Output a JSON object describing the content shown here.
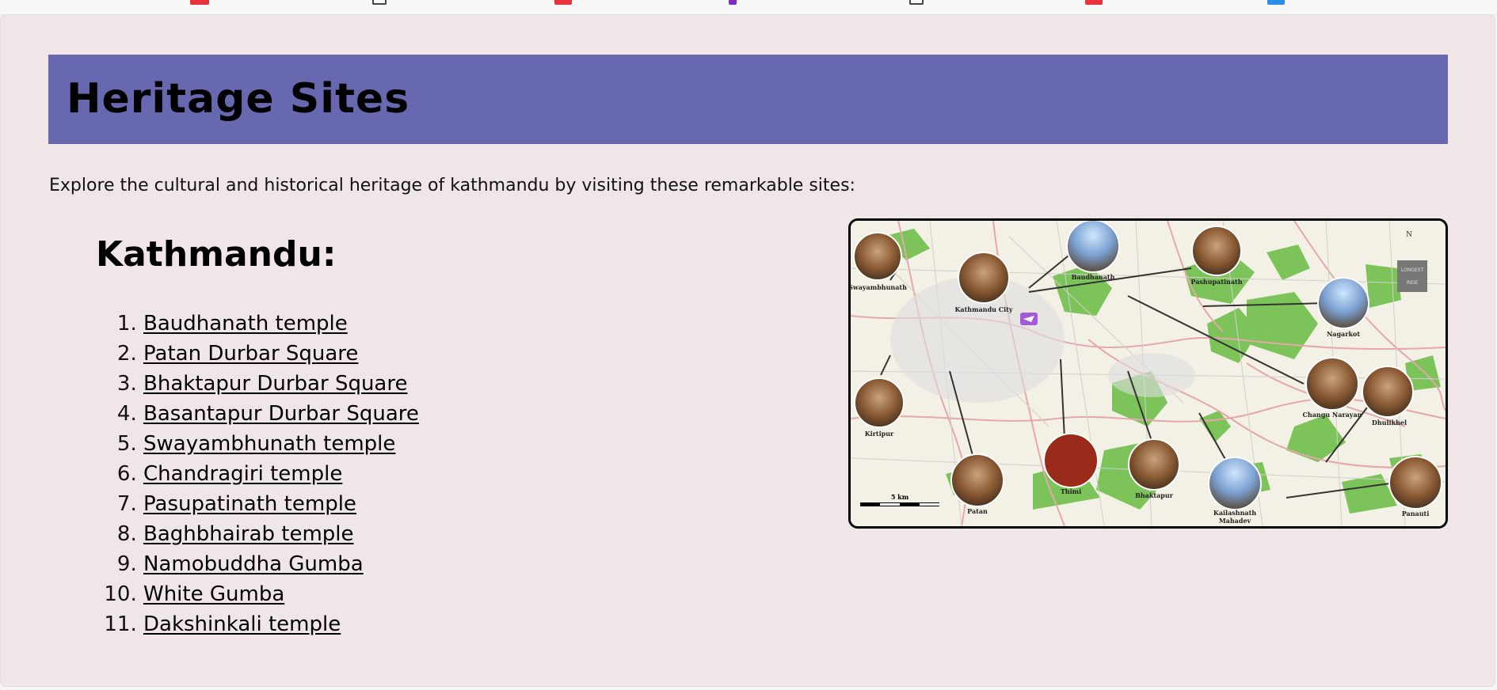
{
  "header": {
    "title": "Heritage Sites"
  },
  "intro_text": "Explore the cultural and historical heritage of kathmandu by visiting these remarkable sites:",
  "region": {
    "title": "Kathmandu:"
  },
  "sites": [
    "Baudhanath temple",
    "Patan Durbar Square",
    "Bhaktapur Durbar Square",
    "Basantapur Durbar Square",
    "Swayambhunath temple",
    "Chandragiri temple",
    "Pasupatinath temple",
    "Baghbhairab temple",
    "Namobuddha Gumba",
    "White Gumba",
    "Dakshinkali temple"
  ],
  "map": {
    "labels": {
      "swayambhunath": "Swayambhunath",
      "kathmandu_city": "Kathmandu City",
      "baudhanath": "Baudhanath",
      "pashupatinath": "Pashupatinath",
      "nagarkot": "Nagarkot",
      "kirtipur": "Kirtipur",
      "changu_narayan": "Changu Narayan",
      "dhulikhel": "Dhulikhel",
      "patan": "Patan",
      "thimi": "Thimi",
      "bhaktapur": "Bhaktapur",
      "kailashnath_mahadev_1": "Kailashnath",
      "kailashnath_mahadev_2": "Mahadev",
      "panauti": "Panauti",
      "scale": "5 km",
      "north": "N",
      "badge_1": "LONGEST",
      "badge_2": "RIDE"
    }
  },
  "colors": {
    "banner": "#6868b1",
    "page_background": "#f0e6e8",
    "map_green": "#7cc35a"
  }
}
